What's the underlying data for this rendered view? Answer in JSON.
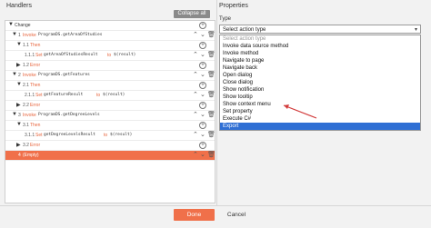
{
  "handlers": {
    "title": "Handlers",
    "collapse_label": "Collapse all",
    "rows": [
      {
        "num": "",
        "keyword": "",
        "text": "Change"
      },
      {
        "num": "1",
        "keyword": "Invoke",
        "text": "ProgramDS.getAreaOfStudies"
      },
      {
        "num": "1.1",
        "keyword": "Then",
        "text": ""
      },
      {
        "num": "1.1.1",
        "keyword": "Set",
        "text": "getAreaOfStudiesResult",
        "keyword2": "to",
        "text2": "$(result)"
      },
      {
        "num": "1.2",
        "keyword": "Error",
        "text": ""
      },
      {
        "num": "2",
        "keyword": "Invoke",
        "text": "ProgramDS.getFeatures"
      },
      {
        "num": "2.1",
        "keyword": "Then",
        "text": ""
      },
      {
        "num": "2.1.1",
        "keyword": "Set",
        "text": "getFeatureResult",
        "keyword2": "to",
        "text2": "$(result)"
      },
      {
        "num": "2.2",
        "keyword": "Error",
        "text": ""
      },
      {
        "num": "3",
        "keyword": "Invoke",
        "text": "ProgramDS.getDegreeLevels"
      },
      {
        "num": "3.1",
        "keyword": "Then",
        "text": ""
      },
      {
        "num": "3.1.1",
        "keyword": "Set",
        "text": "getDegreeLevelsResult",
        "keyword2": "to",
        "text2": "$(result)"
      },
      {
        "num": "3.2",
        "keyword": "Error",
        "text": ""
      },
      {
        "num": "4",
        "keyword": "",
        "text": "(Empty)"
      }
    ]
  },
  "properties": {
    "title": "Properties",
    "type_label": "Type",
    "selected_value": "Select action type",
    "options": [
      "Select action type",
      "Invoke data source method",
      "Invoke method",
      "Navigate to page",
      "Navigate back",
      "Open dialog",
      "Close dialog",
      "Show notification",
      "Show tooltip",
      "Show context menu",
      "Set property",
      "Execute C#",
      "Export"
    ]
  },
  "footer": {
    "done_label": "Done",
    "cancel_label": "Cancel"
  },
  "colors": {
    "accent": "#f0704a",
    "highlight": "#2f6fd4"
  }
}
